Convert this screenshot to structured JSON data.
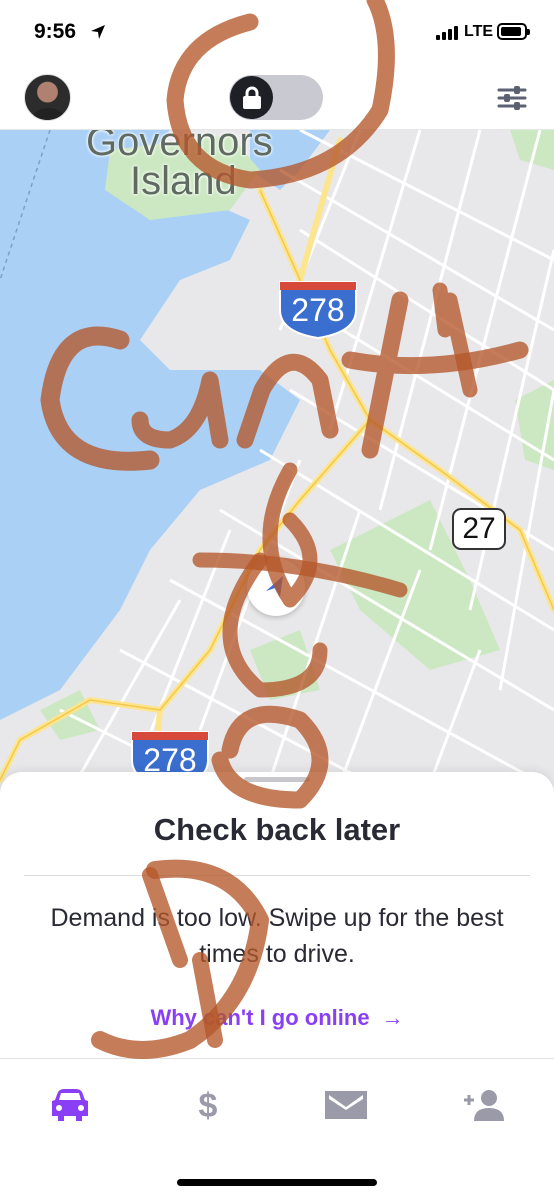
{
  "status_bar": {
    "time": "9:56",
    "network": "LTE",
    "icons": [
      "location-arrow-icon",
      "signal-bars-icon",
      "battery-icon"
    ]
  },
  "header": {
    "avatar_alt": "driver-avatar",
    "toggle_state": "offline",
    "icons": [
      "lock-icon",
      "filter-sliders-icon"
    ]
  },
  "map": {
    "place_label_line1": "Governors",
    "place_label_line2": "Island",
    "highway_shield_top": "278",
    "highway_shield_bottom": "278",
    "route_marker": "27",
    "colors": {
      "water": "#aad0f6",
      "park": "#cce8c2",
      "land": "#e8e8ea",
      "road": "#ffffff",
      "highway": "#fde48e"
    }
  },
  "card": {
    "title": "Check back later",
    "body": "Demand is too low. Swipe up for the best times to drive.",
    "link_label": "Why can't I go online",
    "link_arrow": "→",
    "accent_color": "#8a3ff5"
  },
  "tabbar": {
    "tabs": [
      {
        "name": "drive",
        "icon": "car-icon",
        "active": true
      },
      {
        "name": "earnings",
        "icon": "dollar-icon",
        "active": false
      },
      {
        "name": "inbox",
        "icon": "envelope-icon",
        "active": false
      },
      {
        "name": "refer",
        "icon": "add-person-icon",
        "active": false
      }
    ],
    "active_color": "#8a3ff5",
    "inactive_color": "#9a9aa8"
  },
  "overlay": {
    "handwritten_text": "Cunt"
  }
}
